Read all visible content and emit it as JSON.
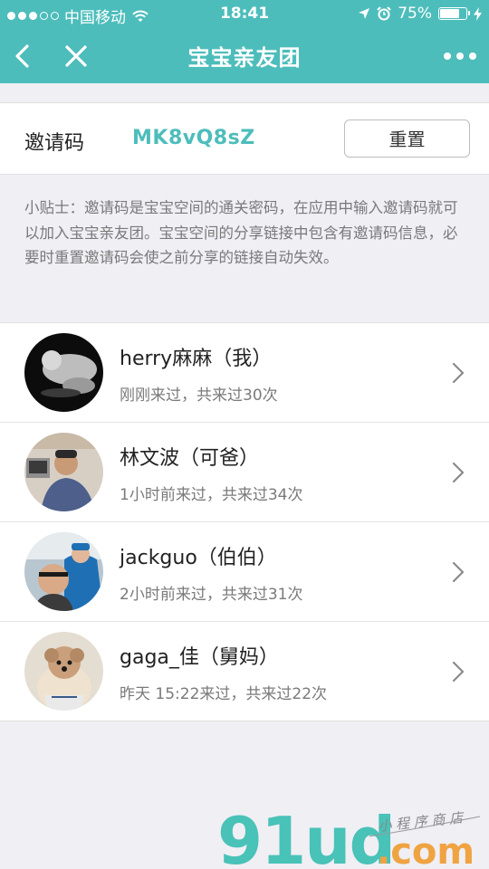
{
  "status_bar": {
    "carrier": "中国移动",
    "time": "18:41",
    "battery_percent": "75%",
    "battery_level": 0.75,
    "signal_dots_filled": 3,
    "signal_dots_total": 5
  },
  "nav": {
    "title": "宝宝亲友团",
    "back_icon": "chevron-left-icon",
    "close_icon": "close-icon",
    "more_icon": "more-dots-icon"
  },
  "invite": {
    "label": "邀请码",
    "code": "MK8vQ8sZ",
    "reset_label": "重置"
  },
  "tip": "小贴士：邀请码是宝宝空间的通关密码，在应用中输入邀请码就可以加入宝宝亲友团。宝宝空间的分享链接中包含有邀请码信息，必要时重置邀请码会使之前分享的链接自动失效。",
  "members": [
    {
      "name": "herry麻麻（我）",
      "visit": "刚刚来过，共来过30次"
    },
    {
      "name": "林文波（可爸）",
      "visit": "1小时前来过，共来过34次"
    },
    {
      "name": "jackguo（伯伯）",
      "visit": "2小时前来过，共来过31次"
    },
    {
      "name": "gaga_佳（舅妈）",
      "visit": "昨天 15:22来过，共来过22次"
    }
  ],
  "watermark": {
    "brand": "91ud",
    "domain": ".com",
    "slogan": "小程序商店"
  },
  "colors": {
    "accent": "#4dbdbb",
    "background": "#efeff4",
    "watermark_teal": "#49c2b8",
    "watermark_orange": "#f0a341"
  }
}
